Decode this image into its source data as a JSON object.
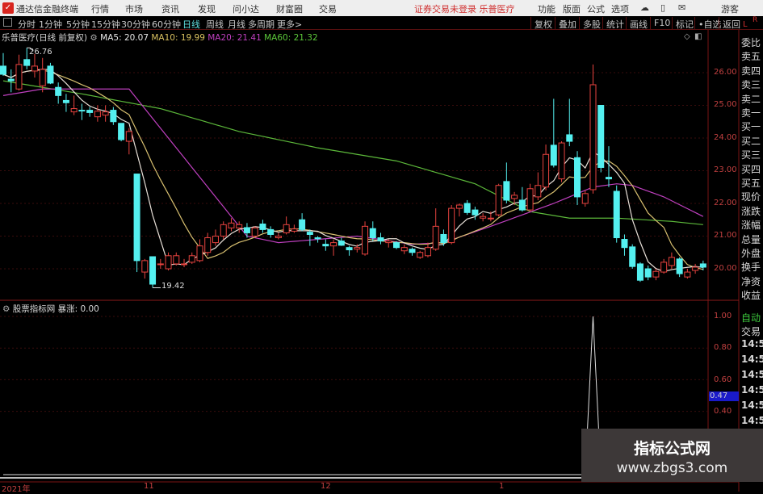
{
  "app": {
    "logo": "✓",
    "title": "通达信金融终端",
    "menu": [
      "行情",
      "市场",
      "资讯",
      "发现",
      "问小达",
      "财富圈",
      "交易"
    ],
    "status": "证券交易未登录  乐普医疗",
    "right_menu": [
      "功能",
      "版面",
      "公式",
      "选项"
    ],
    "user": "游客",
    "icons": [
      "cloud-icon",
      "phone-icon",
      "message-icon"
    ]
  },
  "periods": {
    "items": [
      "分时",
      "1分钟",
      "5分钟",
      "15分钟",
      "30分钟",
      "60分钟",
      "日线",
      "周线",
      "月线",
      "多周期",
      "更多>"
    ],
    "active": "日线"
  },
  "toolbar": [
    "复权",
    "叠加",
    "多股",
    "统计",
    "画线",
    "F10",
    "标记",
    "•自选",
    "返回"
  ],
  "corner": {
    "l": "L",
    "r": "R"
  },
  "info": {
    "stock": "乐普医疗(日线 前复权)",
    "ma5": "MA5: 20.07",
    "ma10": "MA10: 19.99",
    "ma20": "MA20: 21.41",
    "ma60": "MA60: 21.32"
  },
  "indicator": {
    "title": "股票指标网",
    "name": "暴涨: 0.00",
    "axis": [
      "1.00",
      "0.80",
      "0.60",
      "0.40"
    ],
    "cursor_value": "0.47"
  },
  "quote_panel": [
    "委比",
    "卖五",
    "卖四",
    "卖三",
    "卖二",
    "卖一",
    "买一",
    "买二",
    "买三",
    "买四",
    "买五",
    "现价",
    "涨跌",
    "涨幅",
    "总量",
    "外盘",
    "换手",
    "净资",
    "收益"
  ],
  "trade_panel": {
    "auto": "自动",
    "trade": "交易",
    "times": [
      "14:56",
      "14:56",
      "14:56",
      "14:56",
      "14:56",
      "14:56"
    ]
  },
  "watermark": {
    "name": "指标公式网",
    "url": "www.zbgs3.com"
  },
  "chart_data": {
    "type": "candlestick",
    "price_axis": [
      "26.00",
      "25.00",
      "24.00",
      "23.00",
      "22.00",
      "21.00",
      "20.00"
    ],
    "x_labels": [
      "2021年",
      "11",
      "12",
      "1"
    ],
    "high_marker": "26.76",
    "low_marker": "19.42",
    "colors": {
      "up": "#e8433f",
      "down": "#54f0f0",
      "ma5": "#e8e0d8",
      "ma10": "#d8c070",
      "ma20": "#c040c0",
      "ma60": "#5cb83a"
    },
    "ohlc": [
      [
        26.2,
        26.6,
        25.9,
        25.95
      ],
      [
        25.8,
        26.1,
        25.4,
        25.75
      ],
      [
        25.5,
        26.55,
        25.45,
        26.25
      ],
      [
        26.4,
        26.76,
        26.1,
        26.22
      ],
      [
        26.05,
        26.57,
        25.85,
        26.2
      ],
      [
        25.6,
        26.45,
        25.4,
        26.1
      ],
      [
        26.2,
        26.3,
        25.65,
        25.68
      ],
      [
        25.55,
        25.7,
        25.05,
        25.3
      ],
      [
        25.15,
        25.35,
        24.8,
        25.08
      ],
      [
        24.8,
        25.3,
        24.7,
        24.9
      ],
      [
        24.85,
        25.05,
        24.55,
        24.83
      ],
      [
        24.85,
        24.95,
        24.65,
        24.78
      ],
      [
        24.65,
        25.0,
        24.5,
        24.82
      ],
      [
        24.7,
        25.0,
        24.5,
        24.8
      ],
      [
        24.85,
        24.95,
        24.4,
        24.5
      ],
      [
        24.45,
        24.45,
        23.9,
        23.95
      ],
      [
        23.9,
        24.3,
        23.5,
        24.2
      ],
      [
        22.9,
        22.9,
        19.9,
        20.25
      ],
      [
        19.9,
        20.3,
        19.7,
        20.25
      ],
      [
        20.37,
        20.37,
        19.42,
        19.53
      ],
      [
        20.15,
        20.3,
        20.0,
        20.15
      ],
      [
        20.0,
        20.5,
        19.95,
        20.4
      ],
      [
        20.15,
        20.5,
        20.1,
        20.4
      ],
      [
        20.15,
        20.3,
        20.05,
        20.15
      ],
      [
        20.2,
        20.5,
        20.15,
        20.4
      ],
      [
        20.25,
        20.9,
        20.2,
        20.7
      ],
      [
        20.5,
        21.1,
        20.4,
        20.95
      ],
      [
        20.8,
        21.2,
        20.7,
        21.0
      ],
      [
        21.0,
        21.45,
        20.9,
        21.35
      ],
      [
        21.25,
        21.55,
        21.15,
        21.4
      ],
      [
        21.25,
        21.45,
        21.1,
        21.35
      ],
      [
        21.26,
        21.4,
        20.95,
        21.1
      ],
      [
        21.0,
        21.3,
        20.95,
        21.25
      ],
      [
        21.37,
        21.5,
        21.1,
        21.2
      ],
      [
        21.2,
        21.3,
        20.95,
        21.05
      ],
      [
        20.95,
        21.1,
        20.9,
        21.0
      ],
      [
        21.1,
        21.6,
        21.05,
        21.35
      ],
      [
        21.15,
        21.35,
        21.1,
        21.22
      ],
      [
        21.5,
        21.7,
        21.15,
        21.2
      ],
      [
        21.12,
        21.2,
        20.7,
        21.05
      ],
      [
        20.95,
        21.0,
        20.8,
        20.92
      ],
      [
        20.75,
        20.9,
        20.55,
        20.7
      ],
      [
        20.7,
        20.9,
        20.4,
        20.8
      ],
      [
        20.85,
        20.95,
        20.7,
        20.72
      ],
      [
        20.65,
        20.7,
        20.4,
        20.58
      ],
      [
        20.6,
        20.75,
        20.5,
        20.65
      ],
      [
        20.45,
        21.45,
        20.4,
        21.3
      ],
      [
        21.23,
        21.45,
        20.85,
        20.95
      ],
      [
        20.95,
        21.1,
        20.75,
        20.85
      ],
      [
        20.8,
        20.9,
        20.65,
        20.85
      ],
      [
        20.8,
        20.85,
        20.6,
        20.65
      ],
      [
        20.55,
        20.75,
        20.45,
        20.65
      ],
      [
        20.6,
        20.65,
        20.4,
        20.5
      ],
      [
        20.35,
        20.55,
        20.3,
        20.5
      ],
      [
        20.4,
        20.8,
        20.35,
        20.65
      ],
      [
        20.6,
        21.85,
        20.55,
        21.3
      ],
      [
        21.05,
        21.2,
        20.7,
        20.8
      ],
      [
        20.8,
        21.95,
        20.75,
        21.85
      ],
      [
        21.85,
        22.0,
        21.6,
        21.95
      ],
      [
        22.0,
        22.1,
        21.65,
        21.72
      ],
      [
        21.8,
        21.9,
        21.5,
        21.65
      ],
      [
        21.55,
        21.7,
        21.45,
        21.6
      ],
      [
        21.55,
        21.75,
        21.45,
        21.55
      ],
      [
        21.65,
        22.6,
        21.6,
        22.55
      ],
      [
        22.67,
        23.25,
        22.0,
        22.1
      ],
      [
        22.15,
        22.35,
        21.95,
        22.25
      ],
      [
        22.1,
        22.5,
        21.75,
        21.8
      ],
      [
        21.8,
        22.6,
        21.75,
        22.45
      ],
      [
        22.2,
        22.95,
        22.1,
        22.55
      ],
      [
        22.5,
        23.8,
        22.4,
        23.5
      ],
      [
        23.78,
        25.2,
        23.1,
        23.17
      ],
      [
        22.75,
        23.9,
        22.65,
        23.85
      ],
      [
        24.1,
        25.2,
        23.75,
        23.9
      ],
      [
        23.4,
        23.6,
        21.95,
        22.2
      ],
      [
        22.0,
        22.4,
        21.9,
        22.3
      ],
      [
        22.42,
        26.25,
        22.3,
        25.63
      ],
      [
        25.0,
        25.0,
        22.95,
        23.1
      ],
      [
        22.8,
        23.75,
        22.5,
        22.75
      ],
      [
        22.37,
        22.55,
        20.8,
        20.95
      ],
      [
        20.9,
        21.05,
        20.4,
        20.65
      ],
      [
        20.67,
        20.75,
        20.0,
        20.07
      ],
      [
        20.15,
        20.2,
        19.6,
        19.65
      ],
      [
        20.0,
        20.1,
        19.65,
        19.75
      ],
      [
        19.75,
        20.0,
        19.65,
        19.92
      ],
      [
        19.9,
        20.3,
        19.85,
        20.2
      ],
      [
        20.1,
        20.5,
        20.0,
        20.35
      ],
      [
        20.3,
        20.35,
        19.75,
        19.85
      ],
      [
        19.75,
        20.0,
        19.7,
        19.9
      ],
      [
        19.95,
        20.15,
        19.85,
        20.05
      ],
      [
        20.15,
        20.25,
        19.95,
        20.05
      ]
    ],
    "ma20_keypoints": [
      [
        0,
        25.3
      ],
      [
        5,
        25.5
      ],
      [
        16,
        25.5
      ],
      [
        31,
        21.0
      ],
      [
        35,
        20.8
      ],
      [
        45,
        21.0
      ],
      [
        52,
        20.75
      ],
      [
        56,
        20.8
      ],
      [
        62,
        21.3
      ],
      [
        70,
        22.0
      ],
      [
        75,
        22.5
      ],
      [
        78,
        22.6
      ],
      [
        80,
        22.55
      ],
      [
        84,
        22.2
      ],
      [
        89,
        21.6
      ]
    ],
    "ma60_keypoints": [
      [
        0,
        25.75
      ],
      [
        10,
        25.35
      ],
      [
        20,
        24.9
      ],
      [
        30,
        24.2
      ],
      [
        40,
        23.7
      ],
      [
        50,
        23.3
      ],
      [
        60,
        22.6
      ],
      [
        67,
        21.75
      ],
      [
        72,
        21.55
      ],
      [
        78,
        21.55
      ],
      [
        85,
        21.45
      ],
      [
        89,
        21.35
      ]
    ],
    "indicator_values_nonzero": [
      [
        75,
        1.0
      ]
    ]
  }
}
